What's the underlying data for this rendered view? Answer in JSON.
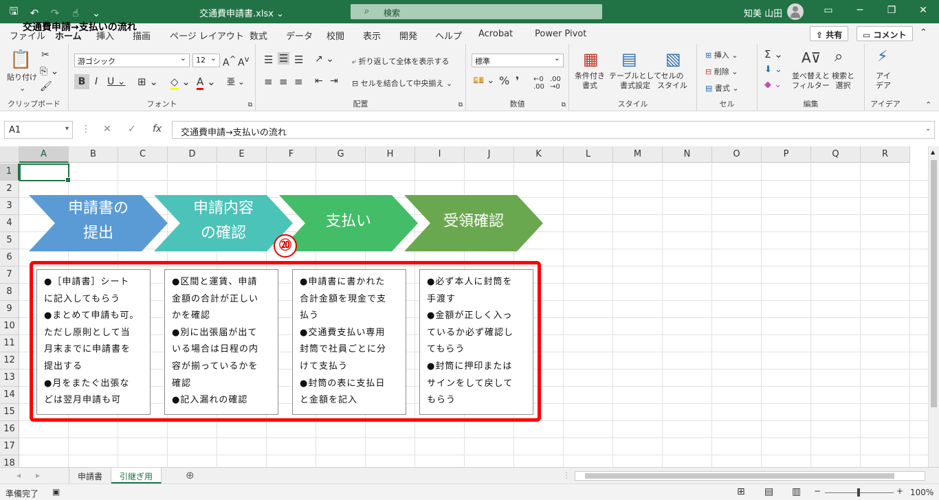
{
  "titlebar": {
    "filename": "交通費申請書.xlsx",
    "search_placeholder": "検索",
    "user": "知美 山田",
    "min_icon": "minimize-icon",
    "max_icon": "restore-icon",
    "close_icon": "close-icon"
  },
  "ribbon_tabs": [
    "ファイル",
    "ホーム",
    "挿入",
    "描画",
    "ページ レイアウト",
    "数式",
    "データ",
    "校閲",
    "表示",
    "開発",
    "ヘルプ",
    "Acrobat",
    "Power Pivot"
  ],
  "share_label": "共有",
  "comment_label": "コメント",
  "ribbon": {
    "clipboard": {
      "paste": "貼り付け",
      "label": "クリップボード"
    },
    "font": {
      "name": "游ゴシック",
      "size": "12",
      "label": "フォント"
    },
    "alignment": {
      "wrap": "折り返して全体を表示する",
      "merge": "セルを結合して中央揃え",
      "label": "配置"
    },
    "number": {
      "format": "標準",
      "label": "数値"
    },
    "styles": {
      "conditional": "条件付き\n書式",
      "table": "テーブルとして\n書式設定",
      "cell": "セルの\nスタイル",
      "label": "スタイル"
    },
    "cells": {
      "insert": "挿入",
      "delete": "削除",
      "format": "書式",
      "label": "セル"
    },
    "editing": {
      "sort": "並べ替えと\nフィルター",
      "find": "検索と\n選択",
      "label": "編集"
    },
    "ideas": {
      "btn": "アイ\nデア",
      "label": "アイデア"
    }
  },
  "formula": {
    "namebox": "A1",
    "content": "交通費申請→支払いの流れ"
  },
  "columns": [
    "A",
    "B",
    "C",
    "D",
    "E",
    "F",
    "G",
    "H",
    "I",
    "J",
    "K",
    "L",
    "M",
    "N",
    "O",
    "P",
    "Q",
    "R"
  ],
  "rows": [
    "1",
    "2",
    "3",
    "4",
    "5",
    "6",
    "7",
    "8",
    "9",
    "10",
    "11",
    "12",
    "13",
    "14",
    "15",
    "16",
    "17",
    "18"
  ],
  "cell_a1": "交通費申請→支払いの流れ",
  "flow_steps": [
    {
      "label": "申請書の\n提出",
      "color": "#5b9bd5"
    },
    {
      "label": "申請内容\nの確認",
      "color": "#4cc3b9"
    },
    {
      "label": "支払い",
      "color": "#43bd68"
    },
    {
      "label": "受領確認",
      "color": "#6aa84f"
    }
  ],
  "step_badge": "⑳",
  "cards": [
    [
      "●［申請書］シート",
      "に記入してもらう",
      "●まとめて申請も可。",
      "ただし原則として当",
      "月末までに申請書を",
      "提出する",
      "●月をまたぐ出張な",
      "どは翌月申請も可"
    ],
    [
      "●区間と運賃、申請",
      "金額の合計が正しい",
      "かを確認",
      "●別に出張届が出て",
      "いる場合は日程の内",
      "容が揃っているかを",
      "確認",
      "●記入漏れの確認"
    ],
    [
      "●申請書に書かれた",
      "合計金額を現金で支",
      "払う",
      "●交通費支払い専用",
      "封筒で社員ごとに分",
      "けて支払う",
      "●封筒の表に支払日",
      "と金額を記入"
    ],
    [
      "●必ず本人に封筒を",
      "手渡す",
      "●金額が正しく入っ",
      "ているか必ず確認し",
      "てもらう",
      "●封筒に押印または",
      "サインをして戻して",
      "もらう"
    ]
  ],
  "sheets": [
    "申請書",
    "引継ぎ用"
  ],
  "status": {
    "ready": "準備完了",
    "zoom": "100%"
  }
}
